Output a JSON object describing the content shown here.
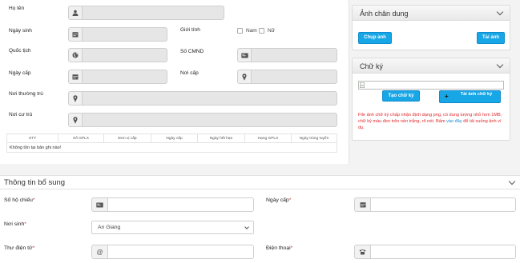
{
  "main_form": {
    "ho_ten_label": "Họ tên",
    "ngay_sinh_label": "Ngày sinh",
    "gioi_tinh_label": "Giới tính",
    "gender_options": [
      "Nam",
      "Nữ"
    ],
    "quoc_tich_label": "Quốc tịch",
    "so_cmnd_label": "Số CMND",
    "ngay_cap_label": "Ngày cấp",
    "noi_cap_label": "Nơi cấp",
    "noi_thuong_tru_label": "Nơi thường trú",
    "noi_cu_tru_label": "Nơi cư trú"
  },
  "gplx_table": {
    "columns": [
      "STT",
      "Số GPLX",
      "Đơn vị cấp",
      "Ngày cấp",
      "Ngày hết hạn",
      "Hạng GPLX",
      "Ngày trúng tuyển"
    ],
    "empty_message": "Không tồn tại bản ghi nào!"
  },
  "portrait_card": {
    "title": "Ảnh chân dung",
    "capture_button": "Chụp ảnh",
    "upload_button": "Tải ảnh"
  },
  "signature_card": {
    "title": "Chữ ký",
    "create_button": "Tạo chữ ký",
    "upload_button": "Tải ảnh chữ ký",
    "upload_icon": "+",
    "note_prefix": "File ảnh chữ ký chấp nhận định dạng png, có dung lượng nhỏ hơn 1MB, chữ ký màu đen trên nền trắng, rõ nét. Bấm",
    "note_link": "vào đây",
    "note_suffix": "để tải xuống ảnh ví dụ."
  },
  "additional_info": {
    "title": "Thông tin bổ sung",
    "so_ho_chieu_label": "Số hộ chiếu",
    "ngay_cap_label": "Ngày cấp",
    "noi_sinh_label": "Nơi sinh",
    "noi_sinh_value": "An Giang",
    "thu_dien_tu_label": "Thư điện tử",
    "dien_thoai_label": "Điện thoại",
    "email_icon_glyph": "@",
    "required_mark": "*"
  },
  "colors": {
    "primary_button": "#17a6e6",
    "required": "#e0292c",
    "link": "#1a8ad4"
  },
  "icons": {
    "ho_ten": "user-icon",
    "ngay_sinh": "calendar-icon",
    "quoc_tich": "globe-icon",
    "so_cmnd": "id-card-icon",
    "ngay_cap": "calendar-icon",
    "noi_cap": "map-marker-icon",
    "noi_thuong_tru": "map-marker-icon",
    "noi_cu_tru": "map-marker-icon"
  }
}
